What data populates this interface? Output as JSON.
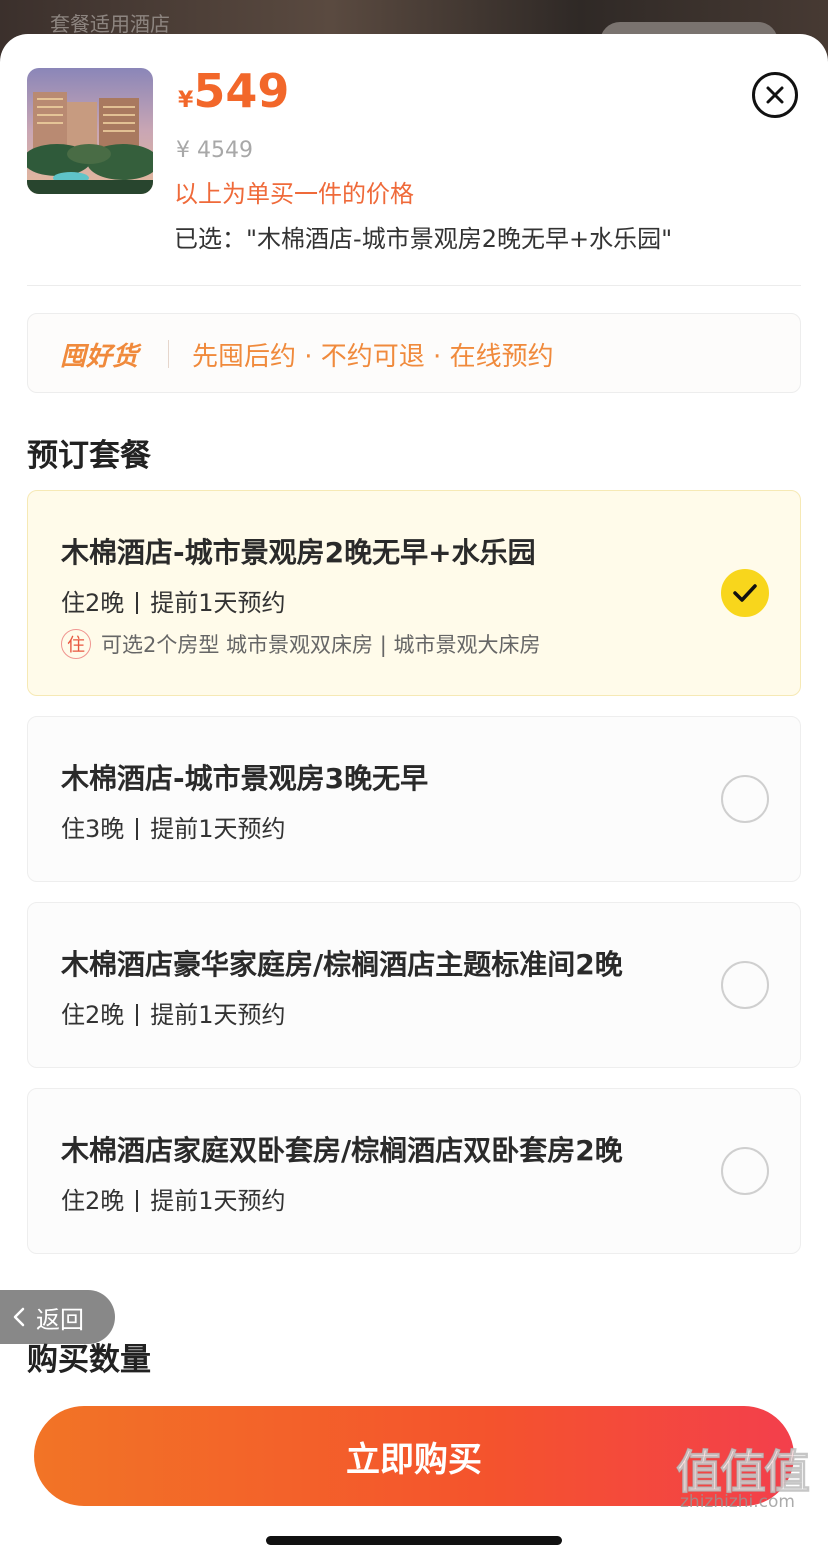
{
  "background": {
    "label": "套餐适用酒店"
  },
  "header": {
    "currency": "¥",
    "price": "549",
    "original_price": "¥ 4549",
    "note": "以上为单买一件的价格",
    "selected": "已选：\"木棉酒店-城市景观房2晚无早+水乐园\""
  },
  "promo": {
    "logo": "囤好货",
    "text": "先囤后约 · 不约可退 · 在线预约"
  },
  "sections": {
    "packages_title": "预订套餐",
    "quantity_title": "购买数量"
  },
  "packages": [
    {
      "title": "木棉酒店-城市景观房2晚无早+水乐园",
      "nights": "住2晚",
      "advance": "提前1天预约",
      "room_tag": "住",
      "room_info": "可选2个房型 城市景观双床房 | 城市景观大床房",
      "selected": true
    },
    {
      "title": "木棉酒店-城市景观房3晚无早",
      "nights": "住3晚",
      "advance": "提前1天预约",
      "selected": false
    },
    {
      "title": "木棉酒店豪华家庭房/棕榈酒店主题标准间2晚",
      "nights": "住2晚",
      "advance": "提前1天预约",
      "selected": false
    },
    {
      "title": "木棉酒店家庭双卧套房/棕榈酒店双卧套房2晚",
      "nights": "住2晚",
      "advance": "提前1天预约",
      "selected": false
    }
  ],
  "back_button": {
    "label": "返回"
  },
  "buy_button": {
    "label": "立即购买"
  },
  "watermark": {
    "text": "值值值",
    "url": "zhizhizhi.com"
  },
  "colors": {
    "accent": "#f2672a",
    "promo": "#f08a3c",
    "check": "#f8d61c",
    "selected_bg": "#fffbea",
    "buy_start": "#f27426",
    "buy_end": "#f33f4c"
  },
  "icons": [
    "close-icon",
    "check-icon",
    "chevron-left-icon"
  ]
}
